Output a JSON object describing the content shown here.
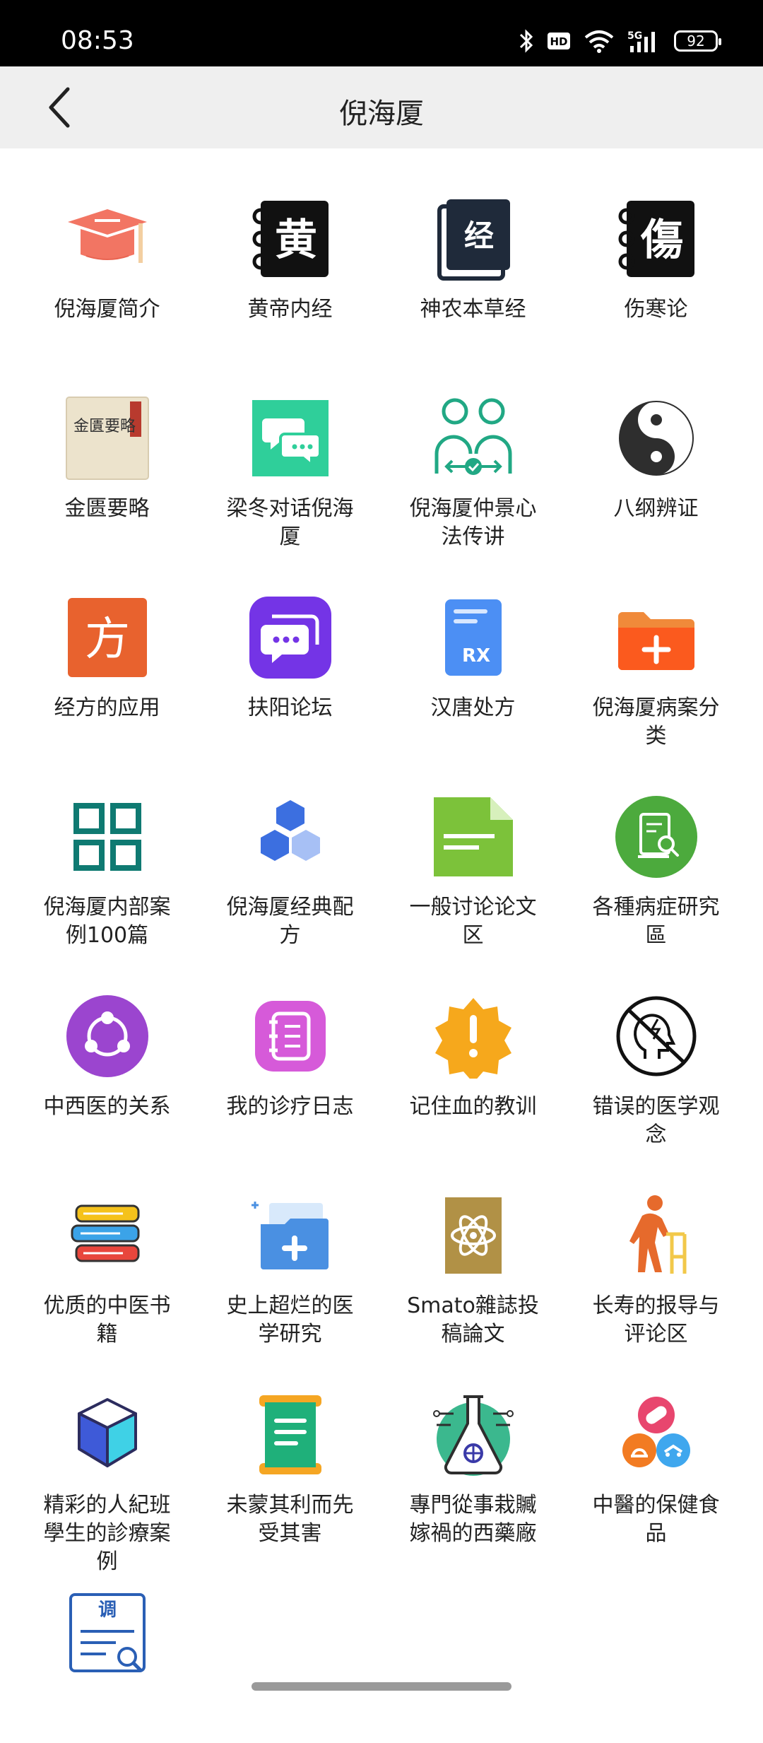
{
  "status": {
    "time": "08:53",
    "battery": "92",
    "icons": [
      "bluetooth-icon",
      "hd-icon",
      "wifi-icon",
      "5g-signal-icon",
      "battery-icon"
    ]
  },
  "header": {
    "title": "倪海厦",
    "back_icon": "chevron-left-icon"
  },
  "tiles": [
    {
      "label": "倪海厦简介",
      "icon": "graduation-cap-icon"
    },
    {
      "label": "黄帝内经",
      "icon": "notebook-huang-icon"
    },
    {
      "label": "神农本草经",
      "icon": "book-jing-icon"
    },
    {
      "label": "伤寒论",
      "icon": "notebook-shang-icon"
    },
    {
      "label": "金匮要略",
      "icon": "book-cover-icon"
    },
    {
      "label": "梁冬对话倪海厦",
      "icon": "chat-bubbles-icon"
    },
    {
      "label": "倪海厦仲景心法传讲",
      "icon": "people-exchange-icon"
    },
    {
      "label": "八纲辨证",
      "icon": "yin-yang-icon"
    },
    {
      "label": "经方的应用",
      "icon": "fang-character-icon"
    },
    {
      "label": "扶阳论坛",
      "icon": "forum-icon"
    },
    {
      "label": "汉唐处方",
      "icon": "prescription-icon"
    },
    {
      "label": "倪海厦病案分类",
      "icon": "folder-plus-icon"
    },
    {
      "label": "倪海厦内部案例100篇",
      "icon": "grid-squares-icon"
    },
    {
      "label": "倪海厦经典配方",
      "icon": "hexagons-icon"
    },
    {
      "label": "一般讨论论文区",
      "icon": "document-icon"
    },
    {
      "label": "各種病症研究區",
      "icon": "book-search-icon"
    },
    {
      "label": "中西医的关系",
      "icon": "share-circle-icon"
    },
    {
      "label": "我的诊疗日志",
      "icon": "journal-icon"
    },
    {
      "label": "记住血的教训",
      "icon": "warning-badge-icon"
    },
    {
      "label": "错误的医学观念",
      "icon": "no-thinking-icon"
    },
    {
      "label": "优质的中医书籍",
      "icon": "book-stack-icon"
    },
    {
      "label": "史上超烂的医学研究",
      "icon": "medical-folder-icon"
    },
    {
      "label": "Smato雜誌投稿論文",
      "icon": "atom-magazine-icon"
    },
    {
      "label": "长寿的报导与评论区",
      "icon": "elderly-walker-icon"
    },
    {
      "label": "精彩的人紀班學生的診療案例",
      "icon": "cube-icon"
    },
    {
      "label": "未蒙其利而先受其害",
      "icon": "scroll-icon"
    },
    {
      "label": "專門從事栽贓嫁禍的西藥廠",
      "icon": "flask-circuit-icon"
    },
    {
      "label": "中醫的保健食品",
      "icon": "health-food-icon"
    },
    {
      "label": "",
      "icon": "survey-search-icon"
    }
  ],
  "icon_text": {
    "huang": "黄",
    "jing": "经",
    "shang": "傷",
    "fang": "方",
    "rx": "RX",
    "diao": "调",
    "book_cover": "金匱要略"
  }
}
